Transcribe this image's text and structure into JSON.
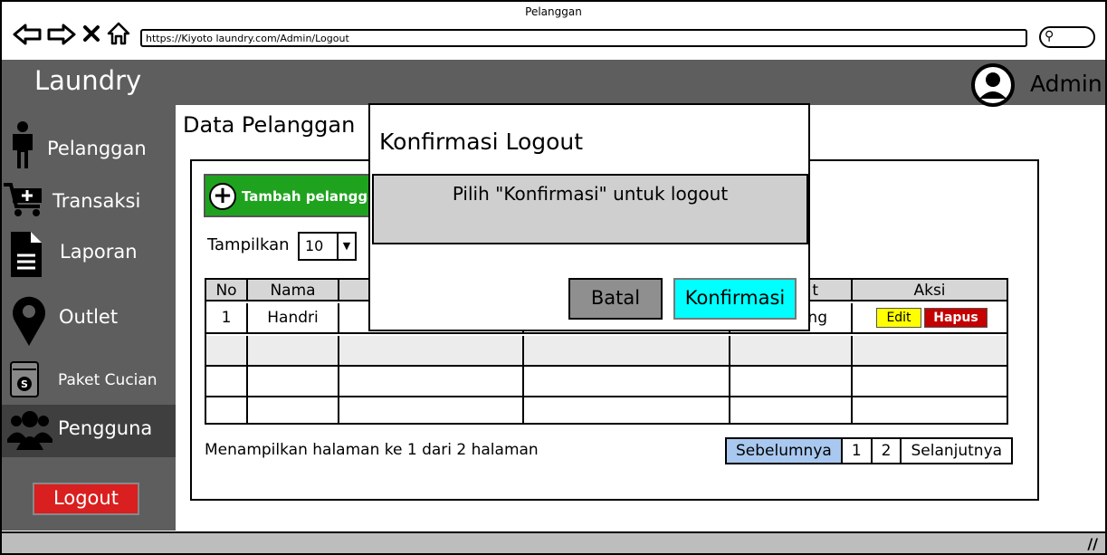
{
  "browser": {
    "title": "Pelanggan",
    "url": "https://Kiyoto laundry.com/Admin/Logout",
    "icons": [
      "back-icon",
      "forward-icon",
      "close-icon",
      "home-icon",
      "search-icon"
    ]
  },
  "header": {
    "brand": "Laundry",
    "user": "Admin"
  },
  "sidebar": {
    "items": [
      {
        "label": "Pelanggan",
        "icon": "person-icon"
      },
      {
        "label": "Transaksi",
        "icon": "cart-icon"
      },
      {
        "label": "Laporan",
        "icon": "document-icon"
      },
      {
        "label": "Outlet",
        "icon": "map-pin-icon"
      },
      {
        "label": "Paket Cucian",
        "icon": "wallet-icon"
      },
      {
        "label": "Pengguna",
        "icon": "users-icon"
      }
    ],
    "logout": "Logout"
  },
  "main": {
    "title": "Data Pelanggan",
    "add_button": "Tambah pelanggan",
    "show_label": "Tampilkan",
    "show_value": "10",
    "table": {
      "headers": [
        "No",
        "Nama",
        "t",
        "Aksi"
      ],
      "rows": [
        {
          "no": "1",
          "nama": "Handri",
          "partial": "ng"
        }
      ],
      "edit_label": "Edit",
      "delete_label": "Hapus"
    },
    "page_info": "Menampilkan halaman ke 1 dari 2 halaman",
    "pager": [
      "Sebelumnya",
      "1",
      "2",
      "Selanjutnya"
    ]
  },
  "modal": {
    "title": "Konfirmasi Logout",
    "message": "Pilih \"Konfirmasi\" untuk logout",
    "cancel": "Batal",
    "confirm": "Konfirmasi"
  },
  "colors": {
    "header": "#5e5e5e",
    "add_button": "#1fa31f",
    "logout": "#d91f1f",
    "confirm": "#00ffff",
    "edit": "#ffff00",
    "delete": "#c40000",
    "pager_active": "#a9c8f0"
  }
}
